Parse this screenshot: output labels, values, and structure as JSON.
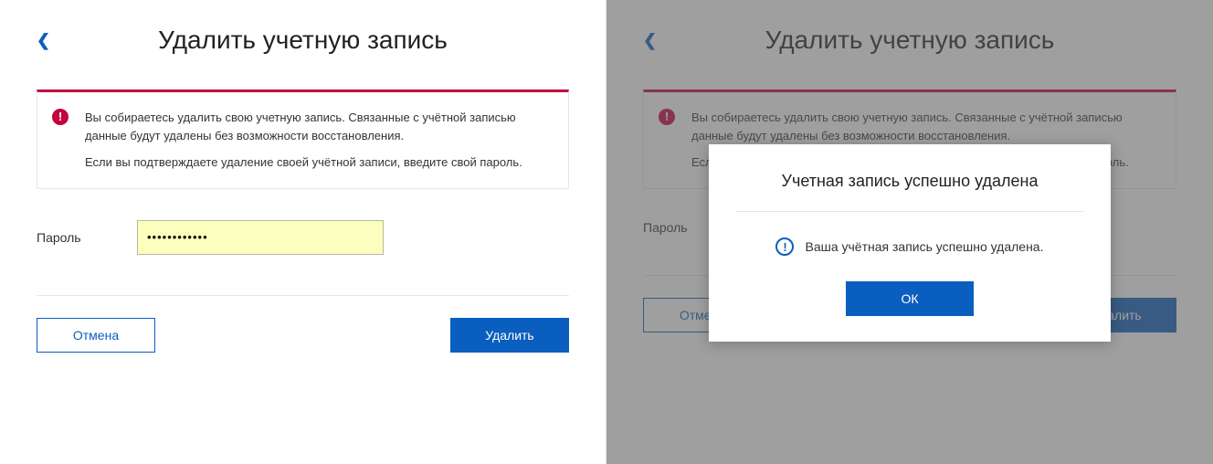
{
  "left": {
    "title": "Удалить учетную запись",
    "warning": {
      "p1": "Вы собираетесь удалить свою учетную запись. Связанные с учётной записью данные будут удалены без возможности восстановления.",
      "p2": "Если вы подтверждаете удаление своей учётной записи, введите свой пароль."
    },
    "password_label": "Пароль",
    "password_value": "••••••••••••",
    "cancel_label": "Отмена",
    "delete_label": "Удалить"
  },
  "right": {
    "title": "Удалить учетную запись",
    "password_label": "Пароль",
    "cancel_label": "Отмена",
    "delete_label": "Удалить",
    "modal": {
      "title": "Учетная запись успешно удалена",
      "body": "Ваша учётная запись успешно удалена.",
      "ok_label": "ОК"
    }
  }
}
